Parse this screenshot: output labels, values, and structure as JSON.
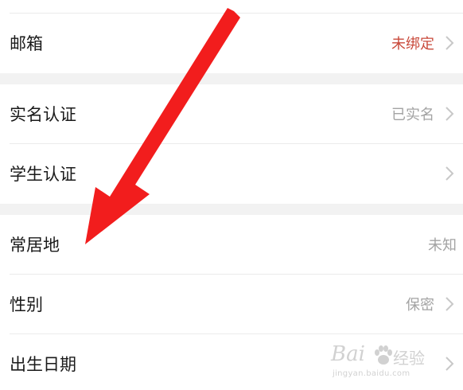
{
  "groups": [
    {
      "rows": [
        {
          "label": "邮箱",
          "value": "未绑定",
          "value_status": "warning",
          "chevron": true
        }
      ]
    },
    {
      "rows": [
        {
          "label": "实名认证",
          "value": "已实名",
          "chevron": true
        },
        {
          "label": "学生认证",
          "value": "",
          "chevron": true
        }
      ]
    },
    {
      "rows": [
        {
          "label": "常居地",
          "value": "未知",
          "chevron": false
        },
        {
          "label": "性别",
          "value": "保密",
          "chevron": true
        },
        {
          "label": "出生日期",
          "value": "",
          "chevron": true
        }
      ]
    }
  ],
  "annotation": {
    "color": "#f21d1d",
    "icon": "red-arrow-icon"
  },
  "colors": {
    "background": "#f2f2f2",
    "row": "#ffffff",
    "label": "#1a1a1a",
    "value": "#a3a3a3",
    "warning": "#c94a3b"
  },
  "watermark": {
    "brand": "Bai",
    "jingyan": "经验",
    "url": "jingyan.baidu.com"
  }
}
